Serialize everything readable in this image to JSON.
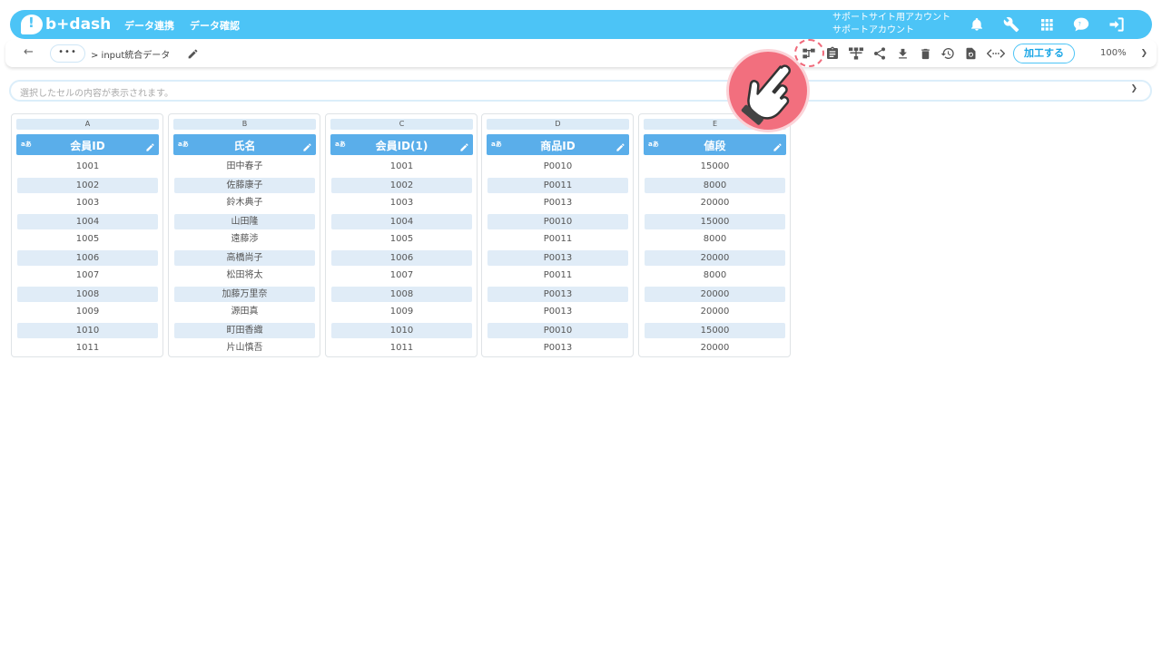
{
  "app": {
    "logo_text": "b+dash",
    "nav": [
      {
        "label": "データ連携"
      },
      {
        "label": "データ確認"
      }
    ],
    "account": {
      "line1": "サポートサイト用アカウント",
      "line2": "サポートアカウント"
    },
    "top_icons": [
      "bell-icon",
      "wrench-icon",
      "grid-apps-icon",
      "chat-help-icon",
      "logout-icon"
    ]
  },
  "toolbar": {
    "back_label": "←",
    "more_label": "•••",
    "breadcrumb": "> input統合データ",
    "tool_icons": [
      "flow-icon",
      "clipboard-icon",
      "hierarchy-icon",
      "share-icon",
      "download-icon",
      "trash-icon",
      "history-icon",
      "refresh-file-icon",
      "code-icon"
    ],
    "process_button": "加工する",
    "zoom": "100%"
  },
  "cell_bar": {
    "placeholder": "選択したセルの内容が表示されます。"
  },
  "columns": [
    {
      "letter": "A",
      "name": "会員ID",
      "type_mark": "aあ",
      "values": [
        "1001",
        "1002",
        "1003",
        "1004",
        "1005",
        "1006",
        "1007",
        "1008",
        "1009",
        "1010",
        "1011"
      ]
    },
    {
      "letter": "B",
      "name": "氏名",
      "type_mark": "aあ",
      "values": [
        "田中春子",
        "佐藤康子",
        "鈴木典子",
        "山田隆",
        "遠藤渉",
        "高橋尚子",
        "松田将太",
        "加藤万里奈",
        "源田真",
        "町田香織",
        "片山慎吾"
      ]
    },
    {
      "letter": "C",
      "name": "会員ID(1)",
      "type_mark": "aあ",
      "values": [
        "1001",
        "1002",
        "1003",
        "1004",
        "1005",
        "1006",
        "1007",
        "1008",
        "1009",
        "1010",
        "1011"
      ]
    },
    {
      "letter": "D",
      "name": "商品ID",
      "type_mark": "aあ",
      "values": [
        "P0010",
        "P0011",
        "P0013",
        "P0010",
        "P0011",
        "P0013",
        "P0011",
        "P0013",
        "P0013",
        "P0010",
        "P0013"
      ]
    },
    {
      "letter": "E",
      "name": "値段",
      "type_mark": "aあ",
      "values": [
        "15000",
        "8000",
        "20000",
        "15000",
        "8000",
        "20000",
        "8000",
        "20000",
        "20000",
        "15000",
        "20000"
      ]
    }
  ],
  "colors": {
    "brand": "#4cc4f6",
    "header_blue": "#5aaeea",
    "row_alt": "#e0ecf7",
    "pointer": "#f26f7e"
  }
}
